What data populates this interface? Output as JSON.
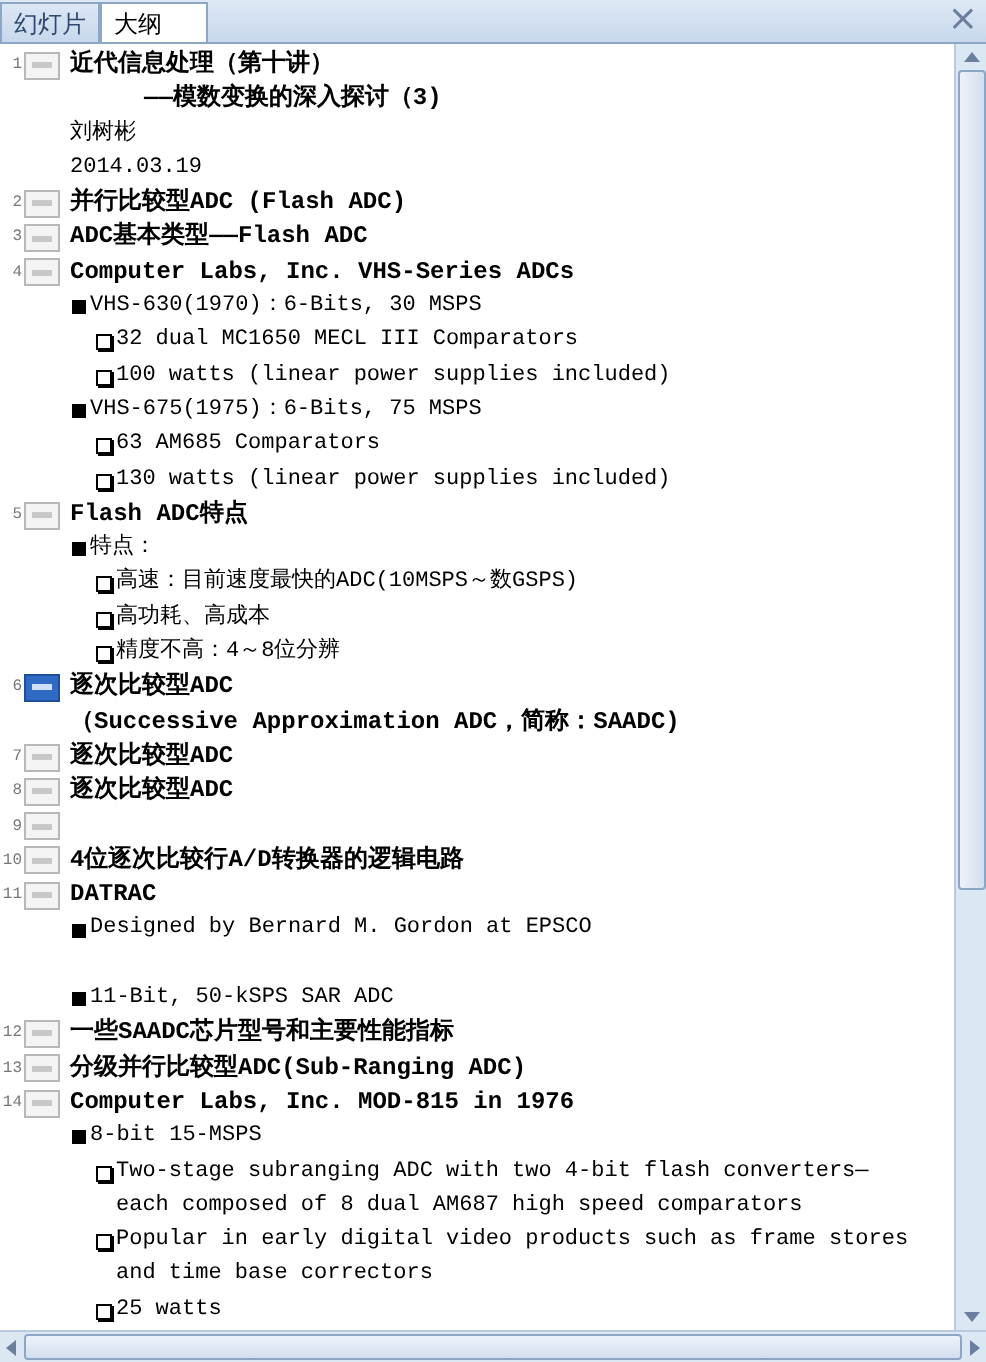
{
  "tabs": [
    {
      "label": "幻灯片",
      "selected": false
    },
    {
      "label": "大纲",
      "selected": true
    }
  ],
  "close": "×",
  "slides": [
    {
      "number": "1",
      "selected": false,
      "lines": [
        {
          "kind": "title",
          "text": "近代信息处理（第十讲）"
        },
        {
          "kind": "subtitle",
          "text": "——模数变换的深入探讨（3)"
        },
        {
          "kind": "plain",
          "text": "刘树彬"
        },
        {
          "kind": "plain",
          "text": "2014.03.19"
        }
      ]
    },
    {
      "number": "2",
      "selected": false,
      "lines": [
        {
          "kind": "title",
          "text": "并行比较型ADC (Flash ADC)"
        }
      ]
    },
    {
      "number": "3",
      "selected": false,
      "lines": [
        {
          "kind": "title",
          "text": "ADC基本类型——Flash ADC"
        }
      ]
    },
    {
      "number": "4",
      "selected": false,
      "lines": [
        {
          "kind": "title",
          "text": "Computer Labs, Inc. VHS-Series ADCs"
        },
        {
          "kind": "bullet",
          "text": "VHS-630(1970)：6-Bits, 30 MSPS"
        },
        {
          "kind": "sub_bullet",
          "text": "32 dual MC1650 MECL III Comparators"
        },
        {
          "kind": "sub_bullet",
          "text": "100 watts (linear power supplies included)"
        },
        {
          "kind": "bullet",
          "text": "VHS-675(1975)：6-Bits, 75 MSPS"
        },
        {
          "kind": "sub_bullet",
          "text": "63 AM685 Comparators"
        },
        {
          "kind": "sub_bullet",
          "text": "130 watts (linear power supplies included)"
        }
      ]
    },
    {
      "number": "5",
      "selected": false,
      "lines": [
        {
          "kind": "title",
          "text": "Flash ADC特点"
        },
        {
          "kind": "bullet",
          "text": "特点："
        },
        {
          "kind": "sub_bullet",
          "text": "高速：目前速度最快的ADC(10MSPS～数GSPS)"
        },
        {
          "kind": "sub_bullet",
          "text": "高功耗、高成本"
        },
        {
          "kind": "sub_bullet",
          "text": "精度不高：4～8位分辨"
        }
      ]
    },
    {
      "number": "6",
      "selected": true,
      "lines": [
        {
          "kind": "title",
          "text": "逐次比较型ADC"
        },
        {
          "kind": "title",
          "text": "（Successive Approximation ADC，简称：SAADC)"
        }
      ]
    },
    {
      "number": "7",
      "selected": false,
      "lines": [
        {
          "kind": "title",
          "text": "逐次比较型ADC"
        }
      ]
    },
    {
      "number": "8",
      "selected": false,
      "lines": [
        {
          "kind": "title",
          "text": "逐次比较型ADC"
        }
      ]
    },
    {
      "number": "9",
      "selected": false
    },
    {
      "number": "10",
      "selected": false,
      "lines": [
        {
          "kind": "title",
          "text": "4位逐次比较行A/D转换器的逻辑电路"
        }
      ]
    },
    {
      "number": "11",
      "selected": false,
      "lines": [
        {
          "kind": "title",
          "text": "DATRAC"
        },
        {
          "kind": "bullet",
          "text": "Designed by Bernard M. Gordon at EPSCO"
        },
        {
          "kind": "bullet",
          "text": "11-Bit, 50-kSPS SAR ADC",
          "blank_before": true
        }
      ]
    },
    {
      "number": "12",
      "selected": false,
      "lines": [
        {
          "kind": "title",
          "text": "一些SAADC芯片型号和主要性能指标"
        }
      ]
    },
    {
      "number": "13",
      "selected": false,
      "lines": [
        {
          "kind": "title",
          "text": "分级并行比较型ADC(Sub-Ranging ADC)"
        }
      ]
    },
    {
      "number": "14",
      "selected": false,
      "lines": [
        {
          "kind": "title",
          "text": "Computer Labs, Inc. MOD-815 in 1976"
        },
        {
          "kind": "bullet",
          "text": "8-bit 15-MSPS"
        },
        {
          "kind": "sub_bullet",
          "text": "Two-stage subranging ADC with two 4-bit flash converters—each composed of 8 dual AM687 high speed comparators"
        },
        {
          "kind": "sub_bullet",
          "text": "Popular in early digital video products such as frame stores and time base correctors"
        },
        {
          "kind": "sub_bullet",
          "text": "25 watts"
        }
      ]
    }
  ]
}
